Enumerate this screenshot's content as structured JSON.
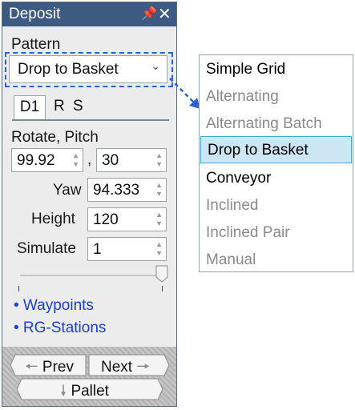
{
  "panel": {
    "title": "Deposit",
    "pattern_label": "Pattern",
    "pattern_value": "Drop to Basket",
    "tabs": [
      "D1",
      "R",
      "S"
    ],
    "rotate_pitch_label": "Rotate, Pitch",
    "rotate_value": "99.92",
    "pitch_separator": ",",
    "pitch_value": "30",
    "yaw_label": "Yaw",
    "yaw_value": "94.333",
    "height_label": "Height",
    "height_value": "120",
    "simulate_label": "Simulate",
    "simulate_value": "1",
    "slider_level": 1.0,
    "links": [
      "• Waypoints",
      "• RG-Stations"
    ],
    "nav": {
      "prev": "Prev",
      "next": "Next",
      "pallet": "Pallet"
    }
  },
  "dropdown_options": [
    {
      "label": "Simple Grid",
      "enabled": true
    },
    {
      "label": "Alternating",
      "enabled": false
    },
    {
      "label": "Alternating Batch",
      "enabled": false
    },
    {
      "label": "Drop to Basket",
      "enabled": true,
      "selected": true
    },
    {
      "label": "Conveyor",
      "enabled": true
    },
    {
      "label": "Inclined",
      "enabled": false
    },
    {
      "label": "Inclined Pair",
      "enabled": false
    },
    {
      "label": "Manual",
      "enabled": false
    }
  ],
  "colors": {
    "titlebar": "#3d5a82",
    "link": "#1a3fd8",
    "selection_fill": "#cde6f3",
    "selection_border": "#4aa8d6",
    "callout": "#2a62d6",
    "disabled_text": "#8a8a8a"
  }
}
